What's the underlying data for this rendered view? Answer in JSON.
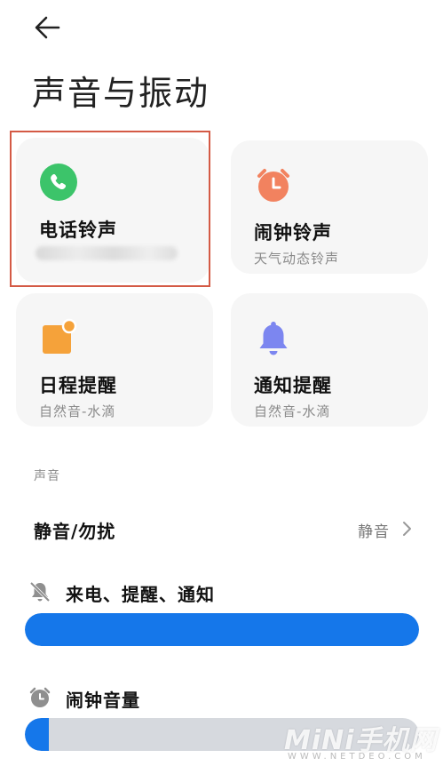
{
  "page": {
    "title": "声音与振动"
  },
  "cards": [
    {
      "id": "phone",
      "title": "电话铃声",
      "subtitle": "",
      "icon": "phone-icon",
      "icon_color": "#3cc46a"
    },
    {
      "id": "alarm",
      "title": "闹钟铃声",
      "subtitle": "天气动态铃声",
      "icon": "alarm-clock-icon",
      "icon_color": "#f2825f"
    },
    {
      "id": "calendar",
      "title": "日程提醒",
      "subtitle": "自然音-水滴",
      "icon": "calendar-note-icon",
      "icon_color": "#f5a23a"
    },
    {
      "id": "notify",
      "title": "通知提醒",
      "subtitle": "自然音-水滴",
      "icon": "bell-icon",
      "icon_color": "#7c86f0"
    }
  ],
  "sound_section": {
    "label": "声音",
    "mute_row": {
      "title": "静音/勿扰",
      "value": "静音"
    },
    "volume_ring": {
      "label": "来电、提醒、通知",
      "level": 1.0
    },
    "volume_alarm": {
      "label": "闹钟音量",
      "level": 0.06
    }
  },
  "watermark": {
    "brand": "MiNi手机网",
    "domain": "WWW.NETDEO.COM"
  },
  "colors": {
    "slider_fill": "#1577ea",
    "slider_track": "#d6d9de",
    "highlight": "#d45a45"
  }
}
